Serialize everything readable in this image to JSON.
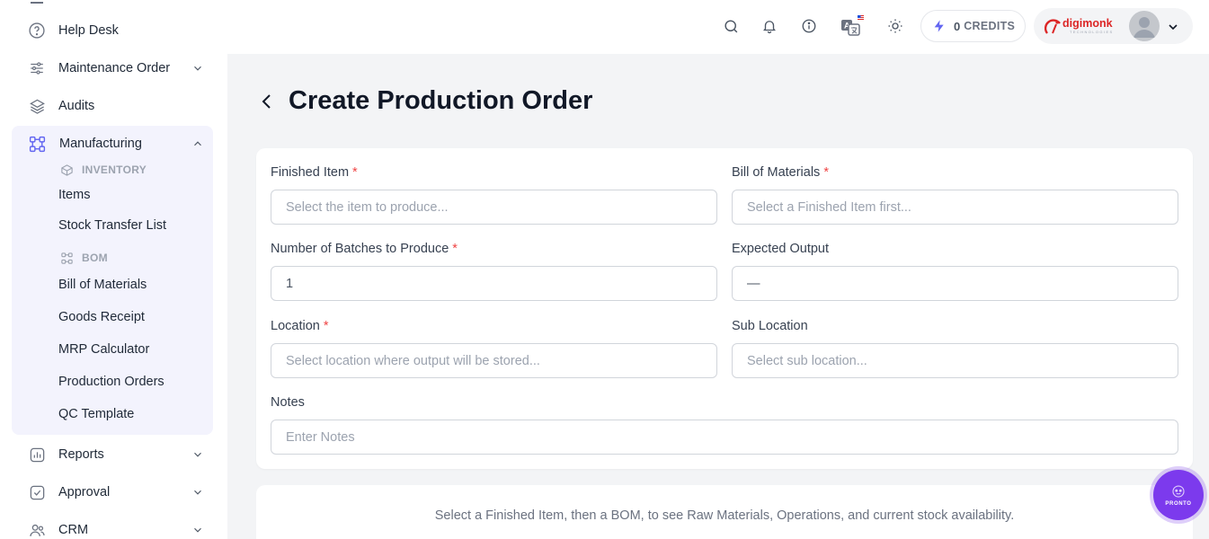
{
  "sidebar": {
    "items_top": [
      {
        "label": "Help Desk",
        "icon": "help-circle-icon"
      },
      {
        "label": "Maintenance Order",
        "icon": "sliders-icon",
        "has_children": true
      },
      {
        "label": "Audits",
        "icon": "layers-icon"
      }
    ],
    "manufacturing": {
      "label": "Manufacturing",
      "icon": "modules-icon",
      "expanded": true,
      "sections": [
        {
          "label": "INVENTORY",
          "icon": "box-icon",
          "items": [
            "Items",
            "Stock Transfer List"
          ]
        },
        {
          "label": "BOM",
          "icon": "modules-icon",
          "items": [
            "Bill of Materials",
            "Goods Receipt",
            "MRP Calculator",
            "Production Orders",
            "QC Template"
          ]
        }
      ]
    },
    "items_bottom": [
      {
        "label": "Reports",
        "icon": "bar-chart-icon",
        "has_children": true
      },
      {
        "label": "Approval",
        "icon": "check-square-icon",
        "has_children": true
      },
      {
        "label": "CRM",
        "icon": "users-icon",
        "has_children": true
      }
    ]
  },
  "topbar": {
    "icons": [
      "search-icon",
      "bell-icon",
      "info-icon",
      "translate-icon",
      "sun-icon"
    ],
    "credits": {
      "value": "0",
      "label": "CREDITS"
    },
    "brand": {
      "name": "digimonk",
      "tagline": "TECHNOLOGIES"
    }
  },
  "page": {
    "title": "Create Production Order"
  },
  "form": {
    "finished_item": {
      "label": "Finished Item",
      "required": true,
      "placeholder": "Select the item to produce..."
    },
    "bill_of_materials": {
      "label": "Bill of Materials",
      "required": true,
      "placeholder": "Select a Finished Item first..."
    },
    "batches": {
      "label": "Number of Batches to Produce",
      "required": true,
      "value": "1"
    },
    "expected_output": {
      "label": "Expected Output",
      "value": "—"
    },
    "location": {
      "label": "Location",
      "required": true,
      "placeholder": "Select location where output will be stored..."
    },
    "sub_location": {
      "label": "Sub Location",
      "placeholder": "Select sub location..."
    },
    "notes": {
      "label": "Notes",
      "placeholder": "Enter Notes"
    }
  },
  "hint": "Select a Finished Item, then a BOM, to see Raw Materials, Operations, and current stock availability.",
  "fab": {
    "label": "PRONTO"
  },
  "colors": {
    "accent": "#6366f1",
    "required": "#ef4444",
    "brand": "#dc2626",
    "fab": "#7c3aed"
  }
}
